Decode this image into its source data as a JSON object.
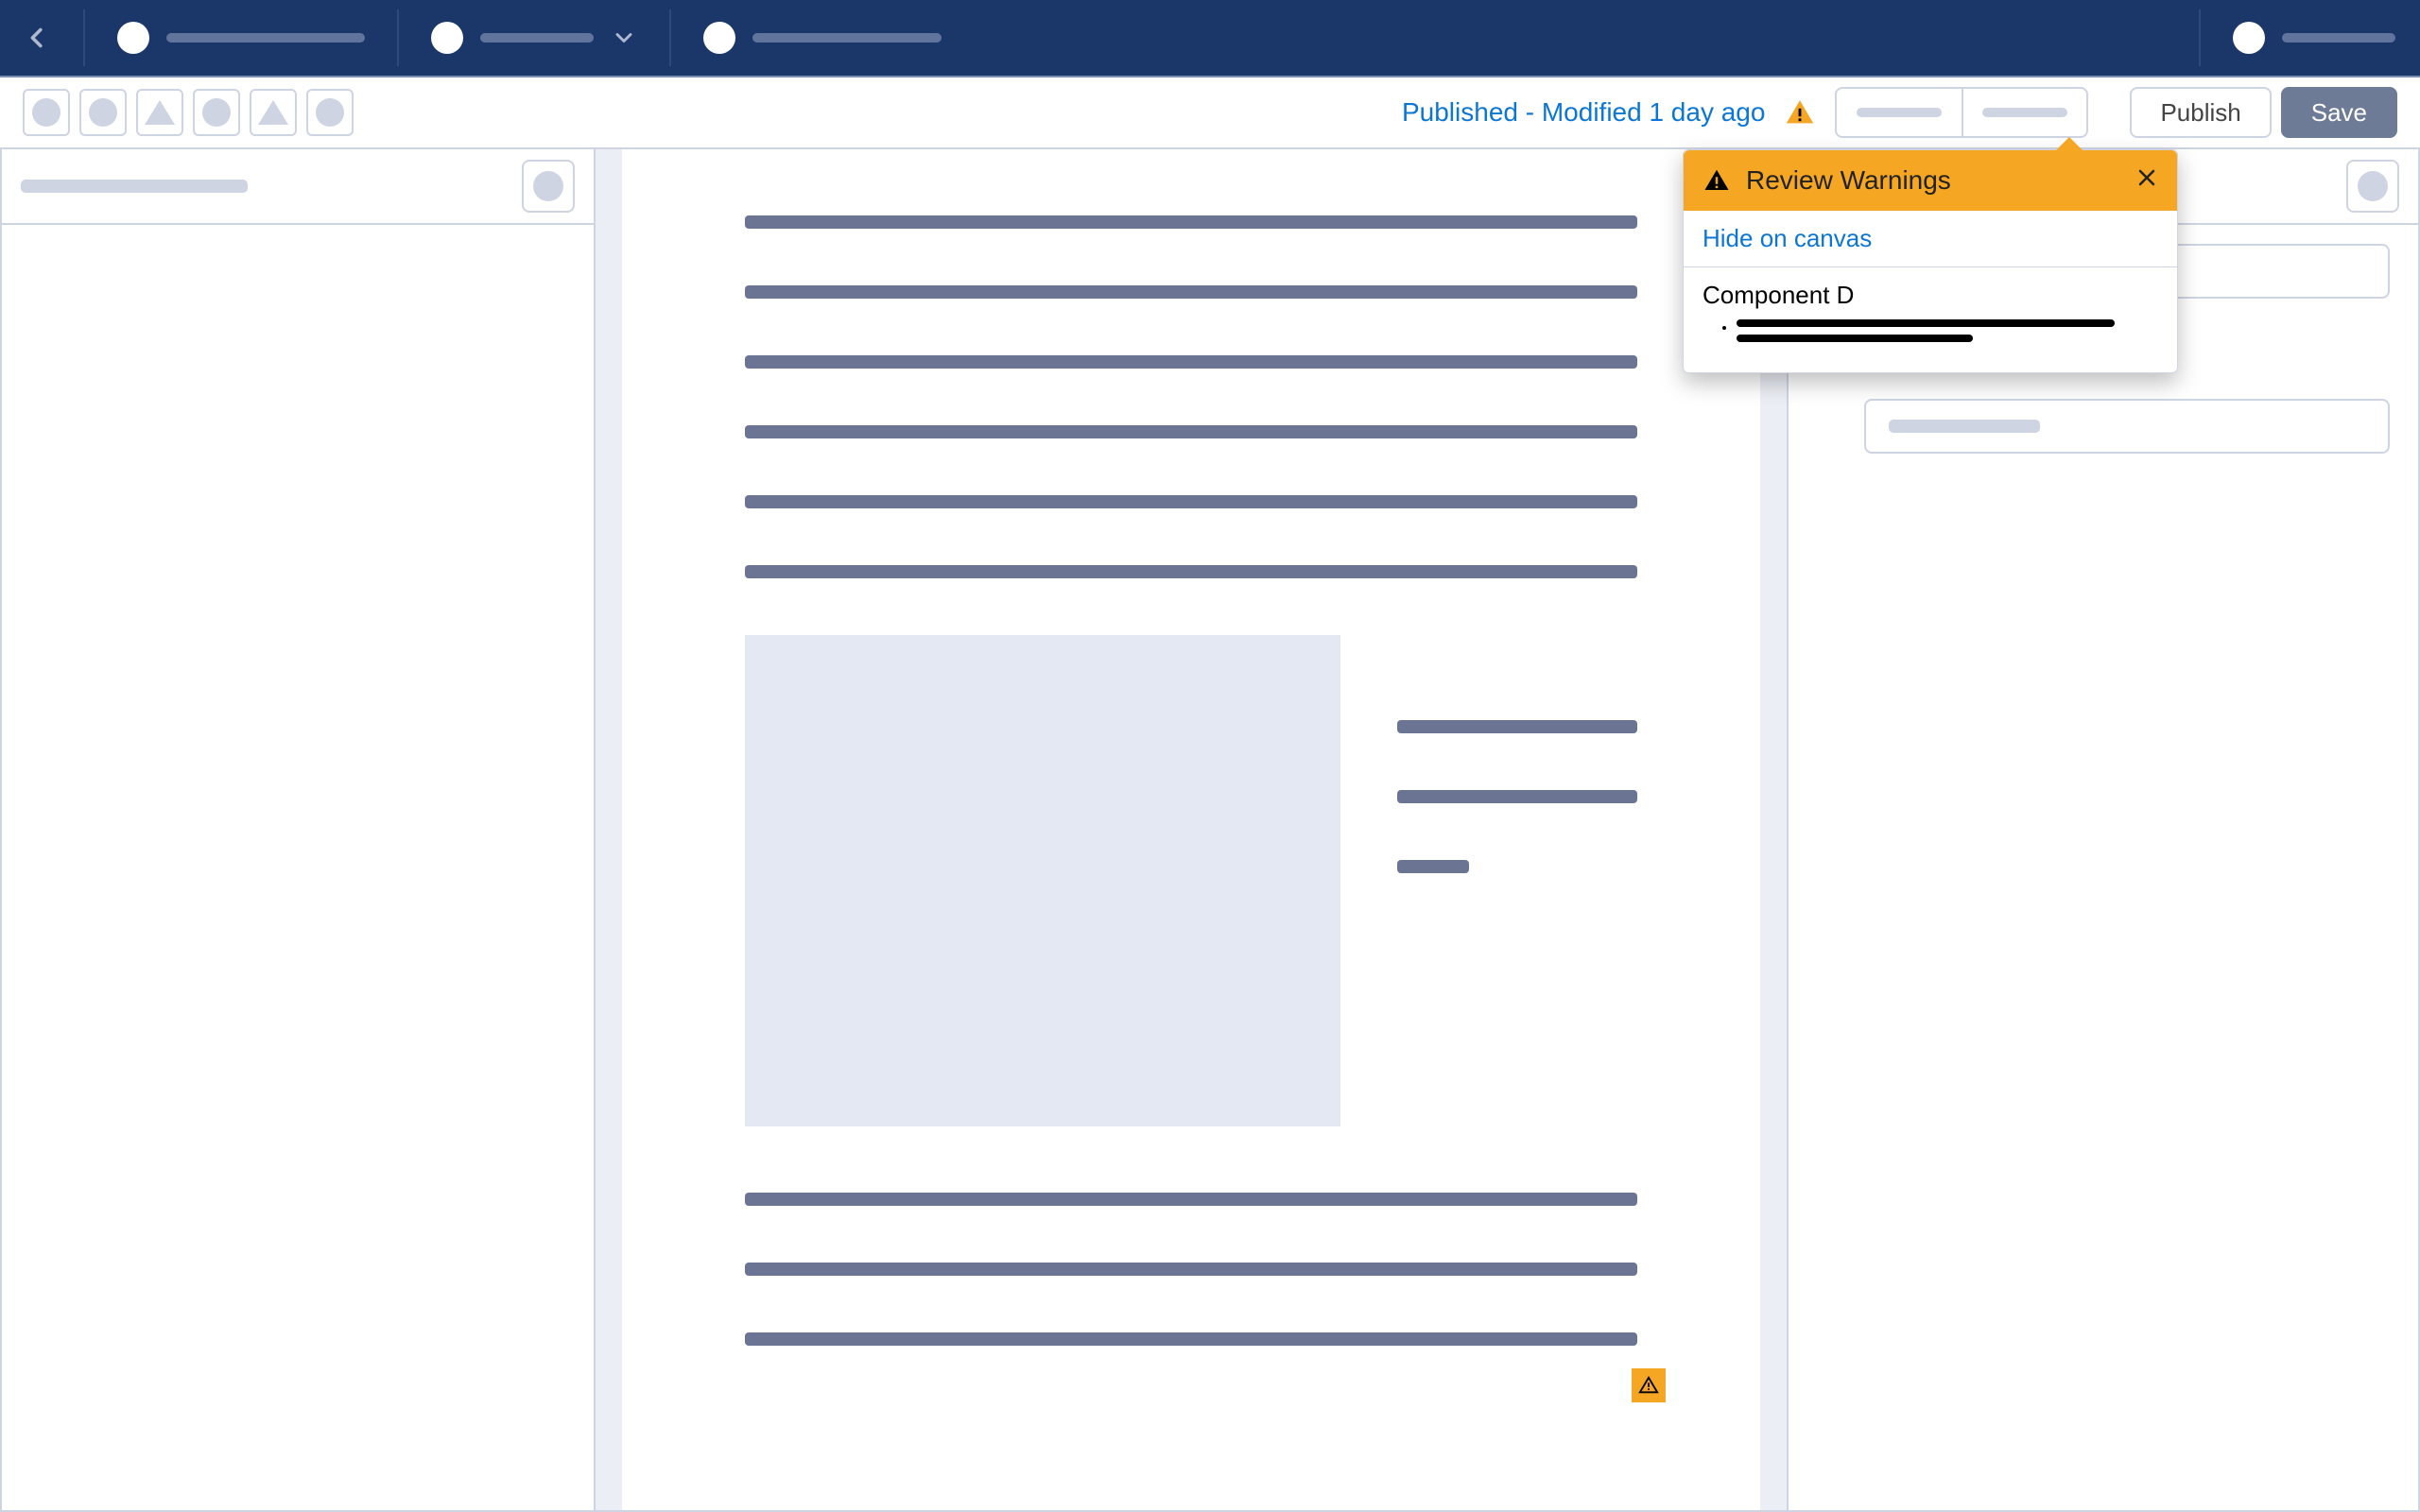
{
  "header": {
    "icon_names": [
      "tab1",
      "tab2",
      "tab3",
      "user"
    ]
  },
  "toolbar": {
    "status_text": "Published - Modified 1 day ago",
    "publish_label": "Publish",
    "save_label": "Save"
  },
  "warnings": {
    "title": "Review Warnings",
    "hide_link": "Hide on canvas",
    "items": [
      {
        "component": "Component D"
      }
    ]
  }
}
